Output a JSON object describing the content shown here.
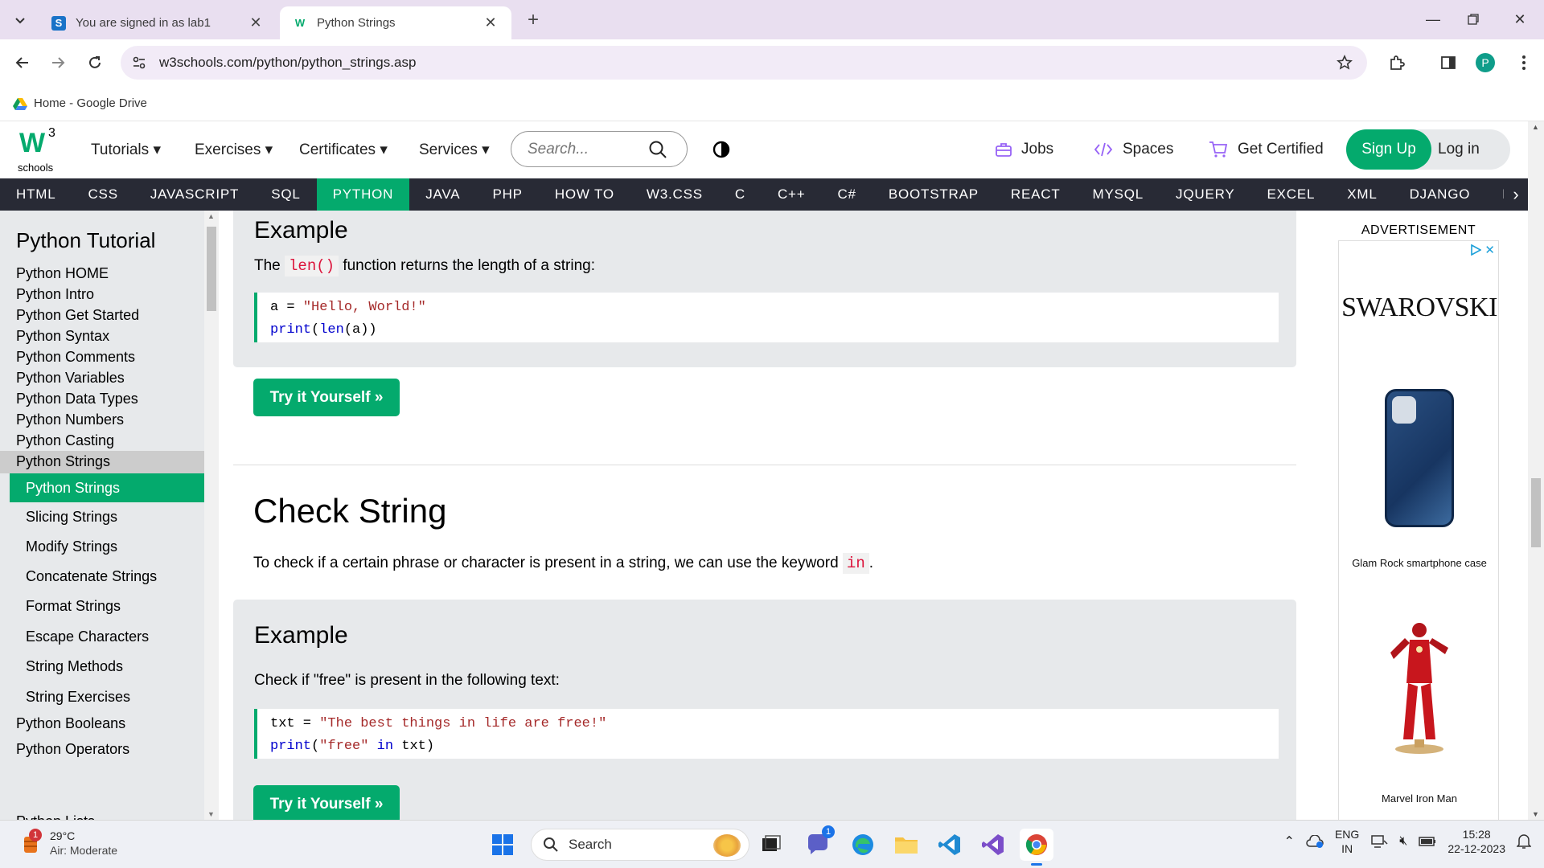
{
  "browser": {
    "tabs": [
      {
        "title": "You are signed in as lab1",
        "favicon": "S"
      },
      {
        "title": "Python Strings",
        "favicon": "W"
      }
    ],
    "url": "w3schools.com/python/python_strings.asp",
    "bookmark": "Home - Google Drive",
    "profile_initial": "P"
  },
  "header": {
    "logo_text": "schools",
    "logo_sup": "3",
    "logo_w": "W",
    "menu": [
      "Tutorials",
      "Exercises",
      "Certificates",
      "Services"
    ],
    "search_placeholder": "Search...",
    "links": [
      "Jobs",
      "Spaces",
      "Get Certified"
    ],
    "signup": "Sign Up",
    "login": "Log in"
  },
  "topnav": {
    "items": [
      "HTML",
      "CSS",
      "JAVASCRIPT",
      "SQL",
      "PYTHON",
      "JAVA",
      "PHP",
      "HOW TO",
      "W3.CSS",
      "C",
      "C++",
      "C#",
      "BOOTSTRAP",
      "REACT",
      "MYSQL",
      "JQUERY",
      "EXCEL",
      "XML",
      "DJANGO",
      "NUMPY"
    ],
    "active": "PYTHON"
  },
  "sidebar": {
    "title": "Python Tutorial",
    "items_top": [
      "Python HOME",
      "Python Intro",
      "Python Get Started",
      "Python Syntax",
      "Python Comments",
      "Python Variables",
      "Python Data Types",
      "Python Numbers",
      "Python Casting"
    ],
    "section": "Python Strings",
    "sub_items": [
      "Python Strings",
      "Slicing Strings",
      "Modify Strings",
      "Concatenate Strings",
      "Format Strings",
      "Escape Characters",
      "String Methods",
      "String Exercises"
    ],
    "items_bottom": [
      "Python Booleans",
      "Python Operators",
      "Python Lists"
    ]
  },
  "content": {
    "example1": {
      "heading": "Example",
      "text_before": "The",
      "code_inline": "len()",
      "text_after": "function returns the length of a string:",
      "code_line1_var": "a = ",
      "code_line1_str": "\"Hello, World!\"",
      "code_line2_fn": "print",
      "code_line2_mid": "(",
      "code_line2_fn2": "len",
      "code_line2_end": "(a))",
      "button": "Try it Yourself »"
    },
    "section2": {
      "title": "Check String",
      "text_before": "To check if a certain phrase or character is present in a string, we can use the keyword",
      "keyword": "in",
      "text_after": "."
    },
    "example2": {
      "heading": "Example",
      "text": "Check if \"free\" is present in the following text:",
      "code_line1_var": "txt = ",
      "code_line1_str": "\"The best things in life are free!\"",
      "code_line2_fn": "print",
      "code_line2_open": "(",
      "code_line2_str": "\"free\"",
      "code_line2_kw": "in",
      "code_line2_end": "txt)",
      "button": "Try it Yourself »"
    }
  },
  "ad": {
    "label": "ADVERTISEMENT",
    "brand": "SWAROVSKI",
    "product1": "Glam Rock smartphone case",
    "product2": "Marvel Iron Man"
  },
  "taskbar": {
    "temp": "29°C",
    "air": "Air: Moderate",
    "weather_badge": "1",
    "search": "Search",
    "chat_badge": "1",
    "lang1": "ENG",
    "lang2": "IN",
    "time": "15:28",
    "date": "22-12-2023"
  },
  "colors": {
    "accent": "#04aa6d",
    "topnav_bg": "#282a35",
    "sidebar_bg": "#e7e9eb"
  }
}
